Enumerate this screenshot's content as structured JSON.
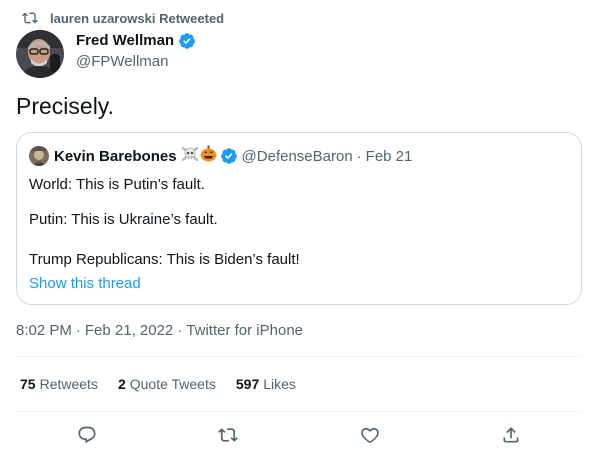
{
  "retweet_context": {
    "text": "lauren uzarowski Retweeted",
    "icon": "retweet-icon"
  },
  "author": {
    "display_name": "Fred Wellman",
    "handle": "@FPWellman",
    "verified": true
  },
  "tweet": {
    "text": "Precisely."
  },
  "quote": {
    "display_name": "Kevin Barebones",
    "emoji": "☠️🎃",
    "verified": true,
    "handle": "@DefenseBaron",
    "separator": "·",
    "date": "Feb 21",
    "lines": [
      "World: This is Putin’s fault.",
      "Putin: This is Ukraine’s fault.",
      "Trump Republicans: This is Biden’s fault!"
    ],
    "show_thread": "Show this thread"
  },
  "meta": {
    "time": "8:02 PM",
    "date": "Feb 21, 2022",
    "separator": "·",
    "source": "Twitter for iPhone"
  },
  "stats": [
    {
      "count": "75",
      "label": "Retweets"
    },
    {
      "count": "2",
      "label": "Quote Tweets"
    },
    {
      "count": "597",
      "label": "Likes"
    }
  ],
  "actions": [
    "reply-icon",
    "retweet-icon",
    "like-icon",
    "share-icon"
  ],
  "colors": {
    "accent": "#1d9bf0",
    "muted": "#536471",
    "text": "#0f1419",
    "border": "#cfd9de"
  }
}
